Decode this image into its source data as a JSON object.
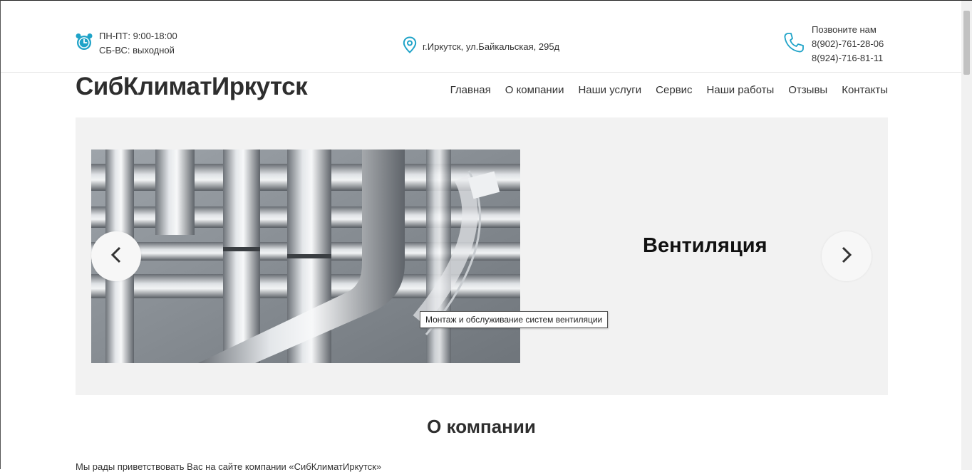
{
  "topbar": {
    "hours": {
      "line1": "ПН-ПТ: 9:00-18:00",
      "line2": "СБ-ВС: выходной",
      "icon": "alarm-clock-icon"
    },
    "address": {
      "text": "г.Иркутск, ул.Байкальская, 295д",
      "icon": "map-pin-icon"
    },
    "phone": {
      "label": "Позвоните нам",
      "phone1": "8(902)-761-28-06",
      "phone2": "8(924)-716-81-11",
      "icon": "phone-icon"
    }
  },
  "header": {
    "logo": "СибКлиматИркутск",
    "nav": [
      "Главная",
      "О компании",
      "Наши услуги",
      "Сервис",
      "Наши работы",
      "Отзывы",
      "Контакты"
    ]
  },
  "slider": {
    "title": "Вентиляция",
    "tooltip": "Монтаж и обслуживание систем вентиляции",
    "prev_icon": "chevron-left-icon",
    "next_icon": "chevron-right-icon"
  },
  "about": {
    "title": "О компании",
    "intro": "Мы рады приветствовать Вас на сайте компании «СибКлиматИркутск»"
  },
  "colors": {
    "accent": "#1fa3c8",
    "slider_bg": "#f2f2f2",
    "text": "#333333"
  }
}
